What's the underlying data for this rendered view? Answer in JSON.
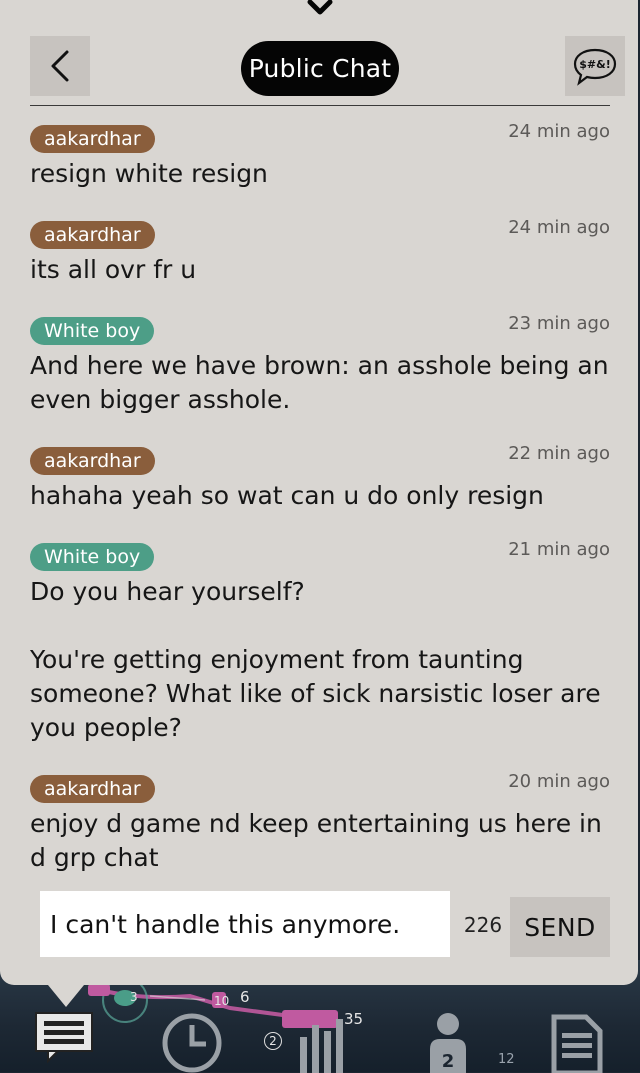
{
  "header": {
    "title": "Public Chat",
    "filter_icon_text": "$#&!"
  },
  "messages": [
    {
      "author": "aakardhar",
      "author_color": "#8a5e3c",
      "time": "24 min ago",
      "text": "resign white resign"
    },
    {
      "author": "aakardhar",
      "author_color": "#8a5e3c",
      "time": "24 min ago",
      "text": "its all ovr fr u"
    },
    {
      "author": "White boy",
      "author_color": "#4d9e87",
      "time": "23 min ago",
      "text": "And here we have brown: an asshole being an even bigger asshole."
    },
    {
      "author": "aakardhar",
      "author_color": "#8a5e3c",
      "time": "22 min ago",
      "text": "hahaha yeah so wat can u do only resign"
    },
    {
      "author": "White boy",
      "author_color": "#4d9e87",
      "time": "21 min ago",
      "text": "Do you hear yourself?\n\nYou're getting enjoyment from taunting someone? What like of sick narsistic loser are you people?"
    },
    {
      "author": "aakardhar",
      "author_color": "#8a5e3c",
      "time": "20 min ago",
      "text": "enjoy d game nd keep entertaining us here in d grp chat"
    }
  ],
  "composer": {
    "value": "I can't handle this anymore.",
    "char_count": "226",
    "send_label": "SEND"
  },
  "game_background": {
    "labels": [
      "3",
      "10",
      "6",
      "35",
      "2",
      "12"
    ]
  },
  "bottom_nav": {
    "items": [
      {
        "icon": "chat-icon",
        "active": true
      },
      {
        "icon": "clock-icon"
      },
      {
        "icon": "stats-icon"
      },
      {
        "icon": "player-icon",
        "badge": "2"
      },
      {
        "icon": "document-icon"
      }
    ]
  },
  "colors": {
    "panel_bg": "#d9d6d2",
    "button_bg": "#c7c3bf",
    "author_brown": "#8a5e3c",
    "author_teal": "#4d9e87"
  }
}
